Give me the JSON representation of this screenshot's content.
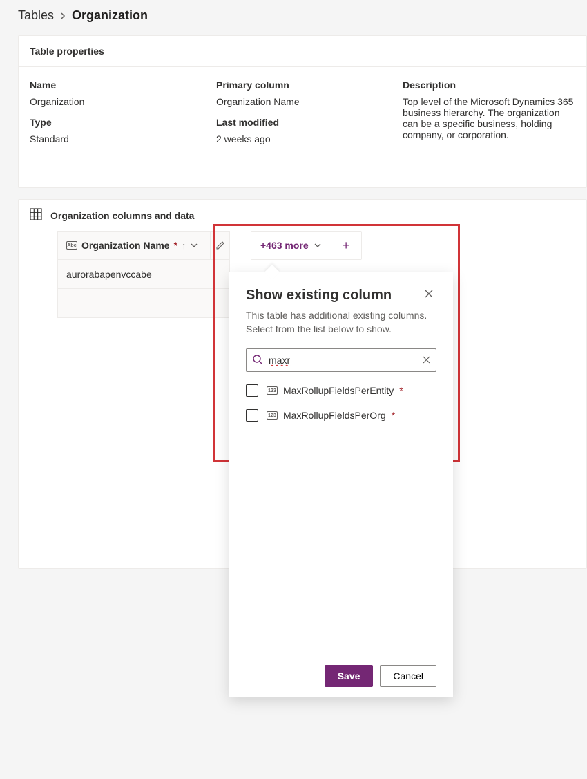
{
  "breadcrumb": {
    "parent": "Tables",
    "current": "Organization"
  },
  "properties": {
    "section_label": "Table properties",
    "name_label": "Name",
    "name_value": "Organization",
    "type_label": "Type",
    "type_value": "Standard",
    "primary_label": "Primary column",
    "primary_value": "Organization Name",
    "modified_label": "Last modified",
    "modified_value": "2 weeks ago",
    "desc_label": "Description",
    "desc_value": "Top level of the Microsoft Dynamics 365 business hierarchy. The organization can be a specific business, holding company, or corporation."
  },
  "columns": {
    "section_label": "Organization columns and data",
    "name_col_label": "Organization Name",
    "more_label": "+463 more",
    "row0_value": "aurorabapenvccabe"
  },
  "panel": {
    "title": "Show existing column",
    "desc": "This table has additional existing columns. Select from the list below to show.",
    "search_value": "maxr",
    "options": [
      {
        "label": "MaxRollupFieldsPerEntity"
      },
      {
        "label": "MaxRollupFieldsPerOrg"
      }
    ],
    "save_label": "Save",
    "cancel_label": "Cancel"
  }
}
